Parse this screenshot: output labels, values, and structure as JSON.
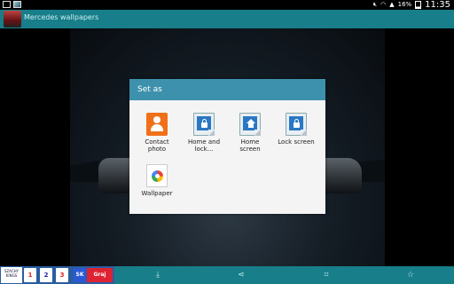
{
  "status_bar": {
    "battery_percent": "16%",
    "time": "11:35",
    "icons": [
      "notification-icon",
      "photo-icon",
      "mute-icon",
      "wifi-icon",
      "signal-icon",
      "battery-icon"
    ]
  },
  "action_bar": {
    "title": "Mercedes wallpapers"
  },
  "dialog": {
    "title": "Set as",
    "options": [
      {
        "label": "Contact\nphoto",
        "icon": "contact-photo-icon"
      },
      {
        "label": "Home and\nlock...",
        "icon": "home-and-lock-icon"
      },
      {
        "label": "Home\nscreen",
        "icon": "home-screen-icon"
      },
      {
        "label": "Lock screen",
        "icon": "lock-screen-icon"
      },
      {
        "label": "Wallpaper",
        "icon": "wallpaper-icon"
      }
    ]
  },
  "bottom_bar": {
    "buttons": [
      "download-icon",
      "share-icon",
      "crop-icon",
      "favorite-icon"
    ]
  },
  "ad_banner": {
    "logo_text": "SZACHY\nKINGS",
    "cards": [
      "1",
      "2",
      "3"
    ],
    "badge": "SK",
    "play_label": "Graj"
  }
}
